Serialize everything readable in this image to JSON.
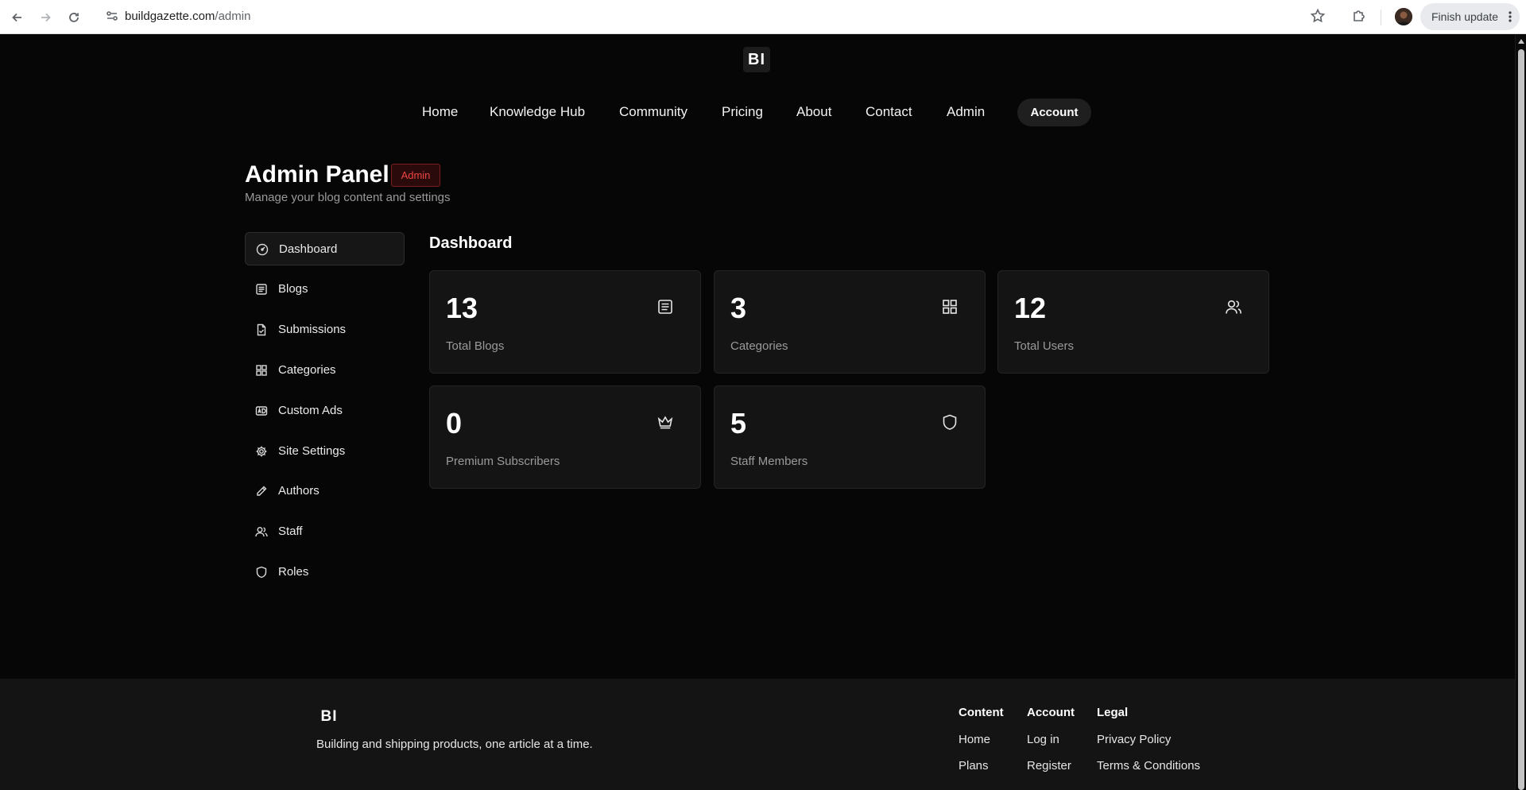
{
  "browser": {
    "url_domain": "buildgazette.com",
    "url_path": "/admin",
    "finish_update": "Finish update"
  },
  "site": {
    "logo": "BI"
  },
  "nav": {
    "items": [
      "Home",
      "Knowledge Hub",
      "Community",
      "Pricing",
      "About",
      "Contact",
      "Admin"
    ],
    "account": "Account"
  },
  "admin": {
    "title": "Admin Panel",
    "badge": "Admin",
    "subtitle": "Manage your blog content and settings",
    "badge_color": "#ef4444"
  },
  "sidebar": {
    "items": [
      {
        "label": "Dashboard",
        "icon": "dashboard-gauge-icon",
        "active": true
      },
      {
        "label": "Blogs",
        "icon": "document-list-icon"
      },
      {
        "label": "Submissions",
        "icon": "file-check-icon"
      },
      {
        "label": "Categories",
        "icon": "grid-icon"
      },
      {
        "label": "Custom Ads",
        "icon": "ad-icon"
      },
      {
        "label": "Site Settings",
        "icon": "gear-icon"
      },
      {
        "label": "Authors",
        "icon": "pencil-icon"
      },
      {
        "label": "Staff",
        "icon": "users-icon"
      },
      {
        "label": "Roles",
        "icon": "shield-icon"
      }
    ]
  },
  "dashboard": {
    "title": "Dashboard",
    "cards": [
      {
        "value": "13",
        "label": "Total Blogs",
        "icon": "document-list-icon"
      },
      {
        "value": "3",
        "label": "Categories",
        "icon": "grid-icon"
      },
      {
        "value": "12",
        "label": "Total Users",
        "icon": "users-icon"
      },
      {
        "value": "0",
        "label": "Premium Subscribers",
        "icon": "crown-icon"
      },
      {
        "value": "5",
        "label": "Staff Members",
        "icon": "shield-icon"
      }
    ]
  },
  "footer": {
    "logo": "BI",
    "tagline": "Building and shipping products, one article at a time.",
    "columns": [
      {
        "heading": "Content",
        "links": [
          "Home",
          "Plans"
        ]
      },
      {
        "heading": "Account",
        "links": [
          "Log in",
          "Register"
        ]
      },
      {
        "heading": "Legal",
        "links": [
          "Privacy Policy",
          "Terms & Conditions"
        ]
      }
    ]
  }
}
